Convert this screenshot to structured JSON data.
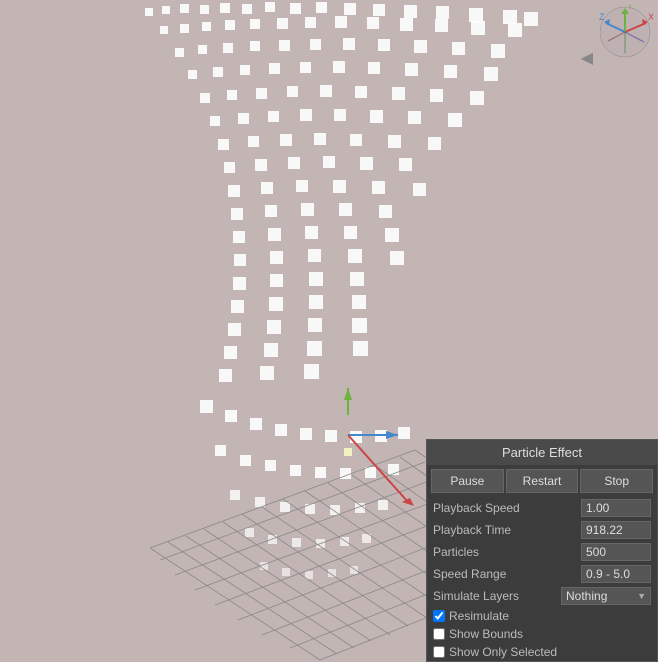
{
  "panel": {
    "title": "Particle Effect",
    "buttons": {
      "pause": "Pause",
      "restart": "Restart",
      "stop": "Stop"
    },
    "fields": {
      "playback_speed_label": "Playback Speed",
      "playback_speed_value": "1.00",
      "playback_time_label": "Playback Time",
      "playback_time_value": "918.22",
      "particles_label": "Particles",
      "particles_value": "500",
      "speed_range_label": "Speed Range",
      "speed_range_value": "0.9 - 5.0",
      "simulate_layers_label": "Simulate Layers",
      "simulate_layers_value": "Nothing"
    },
    "checkboxes": {
      "resimulate_label": "Resimulate",
      "resimulate_checked": true,
      "show_bounds_label": "Show Bounds",
      "show_bounds_checked": false,
      "show_only_selected_label": "Show Only Selected",
      "show_only_selected_checked": false
    }
  },
  "viewport": {
    "back_arrow": "◀"
  }
}
